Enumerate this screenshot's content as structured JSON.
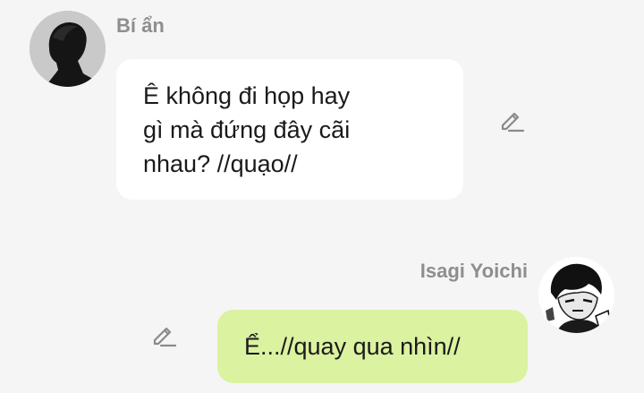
{
  "messages": [
    {
      "sender": "Bí ẩn",
      "side": "left",
      "text": "Ê không đi họp hay\ngì mà đứng đây cãi\nnhau? //quạo//",
      "avatar_icon": "silhouette-avatar-icon",
      "action_icon": "edit-pencil-icon"
    },
    {
      "sender": "Isagi Yoichi",
      "side": "right",
      "text": "Ể...//quay qua nhìn//",
      "avatar_icon": "manga-character-avatar-icon",
      "action_icon": "edit-pencil-icon"
    }
  ],
  "colors": {
    "background": "#f5f5f5",
    "incoming_bubble": "#ffffff",
    "outgoing_bubble": "#dbf2a0",
    "sender_name": "#8e8e8e",
    "message_text": "#1a1a1a",
    "icon": "#8a8a8a"
  }
}
